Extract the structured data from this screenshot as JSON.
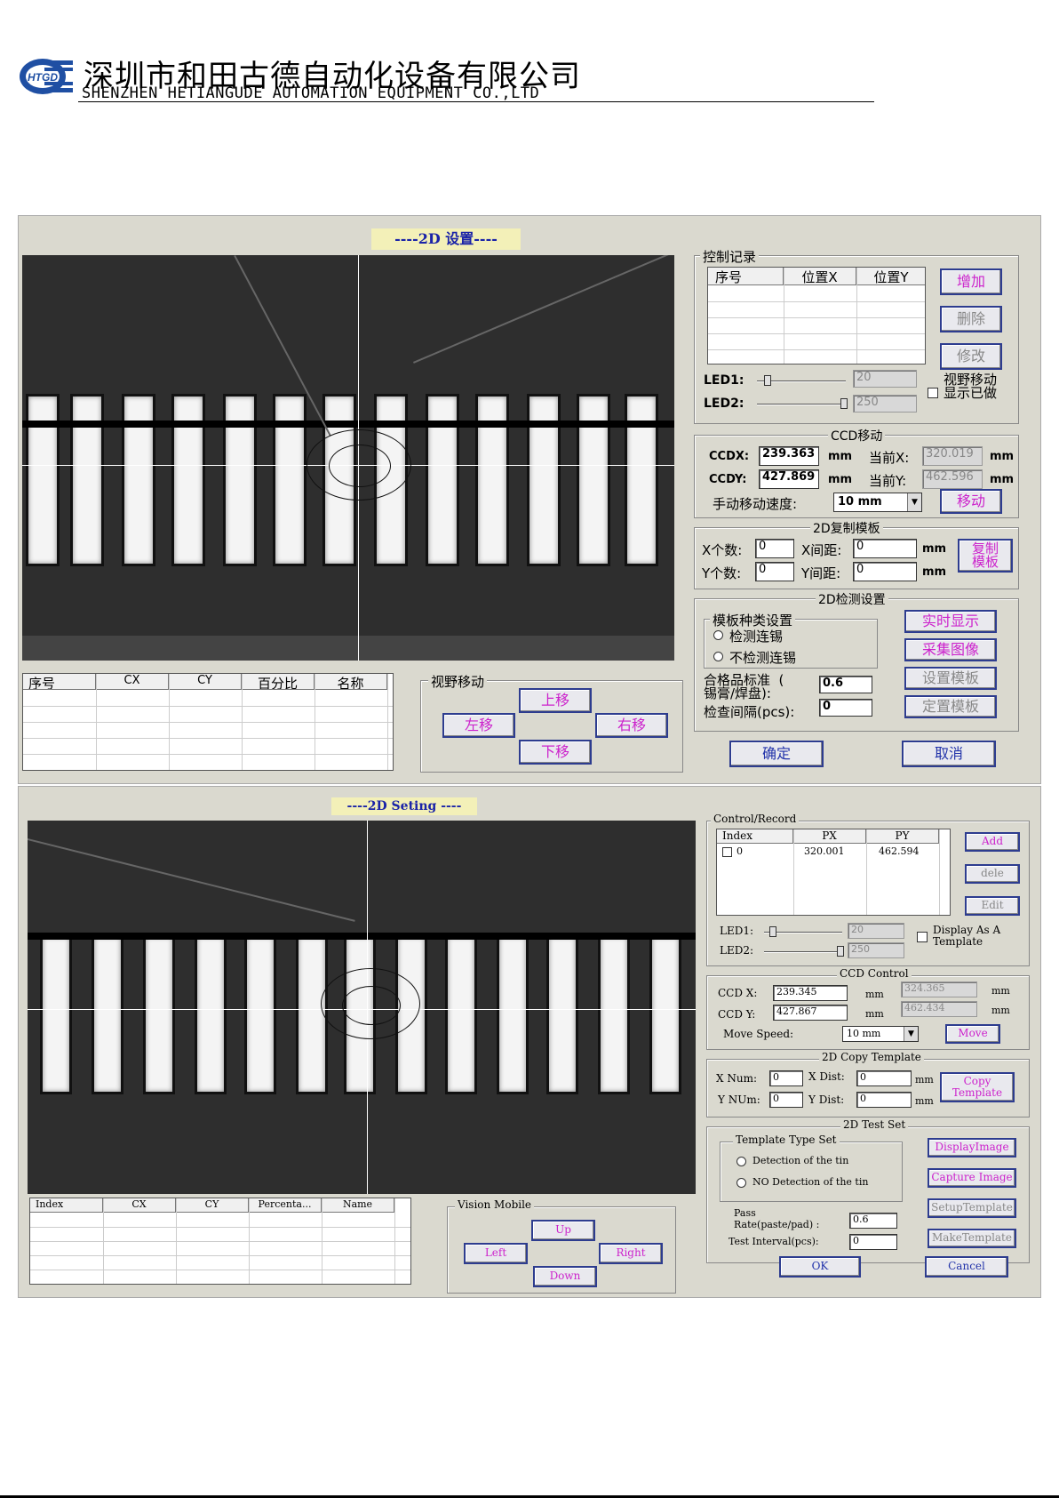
{
  "header": {
    "company_cn": "深圳市和田古德自动化设备有限公司",
    "company_en": "SHENZHEN HETIANGUDE AUTOMATION EQUIPMENT CO.,LTD",
    "logo_text": "HTGD",
    "logo_color": "#1f4fa3"
  },
  "cn": {
    "title": "----2D 设置----",
    "record": {
      "title": "控制记录",
      "columns": [
        "序号",
        "位置X",
        "位置Y"
      ],
      "add": "增加",
      "delete": "删除",
      "edit": "修改",
      "led1_label": "LED1:",
      "led1_value": "20",
      "led2_label": "LED2:",
      "led2_value": "250",
      "display_check": "视野移动\n显示已做"
    },
    "ccd": {
      "title": "CCD移动",
      "x_label": "CCDX:",
      "x_value": "239.363",
      "x_unit": "mm",
      "cur_x_label": "当前X:",
      "cur_x_value": "320.019",
      "cur_x_unit": "mm",
      "y_label": "CCDY:",
      "y_value": "427.869",
      "y_unit": "mm",
      "cur_y_label": "当前Y:",
      "cur_y_value": "462.596",
      "cur_y_unit": "mm",
      "speed_label": "手动移动速度:",
      "speed_value": "10 mm",
      "move": "移动"
    },
    "copy": {
      "title": "2D复制模板",
      "xnum_label": "X个数:",
      "xnum_value": "0",
      "xdist_label": "X间距:",
      "xdist_value": "0",
      "xdist_unit": "mm",
      "ynum_label": "Y个数:",
      "ynum_value": "0",
      "ydist_label": "Y间距:",
      "ydist_value": "0",
      "ydist_unit": "mm",
      "copy_btn": "复制\n模板"
    },
    "test": {
      "title": "2D检测设置",
      "type_title": "模板种类设置",
      "opt1": "检测连锡",
      "opt2": "不检测连锡",
      "display": "实时显示",
      "capture": "采集图像",
      "setup": "设置模板",
      "make": "定置模板",
      "pass_label": "合格品标准  (\n锡膏/焊盘):",
      "pass_value": "0.6",
      "interval_label": "检查间隔(pcs):",
      "interval_value": "0"
    },
    "ok": "确定",
    "cancel": "取消",
    "list_columns": [
      "序号",
      "CX",
      "CY",
      "百分比",
      "名称"
    ],
    "vision": {
      "title": "视野移动",
      "up": "上移",
      "left": "左移",
      "right": "右移",
      "down": "下移"
    }
  },
  "en": {
    "title": "----2D Seting ----",
    "record": {
      "title": "Control/Record",
      "columns": [
        "Index",
        "PX",
        "PY"
      ],
      "row_index": "0",
      "row_px": "320.001",
      "row_py": "462.594",
      "add": "Add",
      "delete": "dele",
      "edit": "Edit",
      "led1_label": "LED1:",
      "led1_value": "20",
      "led2_label": "LED2:",
      "led2_value": "250",
      "display_check": "Display As A\nTemplate"
    },
    "ccd": {
      "title": "CCD Control",
      "x_label": "CCD X:",
      "x_value": "239.345",
      "x_unit": "mm",
      "cur_x_value": "324.365",
      "cur_x_unit": "mm",
      "y_label": "CCD Y:",
      "y_value": "427.867",
      "y_unit": "mm",
      "cur_y_value": "462.434",
      "cur_y_unit": "mm",
      "speed_label": "Move  Speed:",
      "speed_value": "10 mm",
      "move": "Move"
    },
    "copy": {
      "title": "2D Copy Template",
      "xnum_label": "X  Num:",
      "xnum_value": "0",
      "xdist_label": "X Dist:",
      "xdist_value": "0",
      "xdist_unit": "mm",
      "ynum_label": "Y NUm:",
      "ynum_value": "0",
      "ydist_label": "Y Dist:",
      "ydist_value": "0",
      "ydist_unit": "mm",
      "copy_btn": "Copy\nTemplate"
    },
    "test": {
      "title": "2D Test Set",
      "type_title": "Template Type Set",
      "opt1": "Detection of the tin",
      "opt2": "NO Detection of the tin",
      "display": "DisplayImage",
      "capture": "Capture Image",
      "setup": "SetupTemplate",
      "make": "MakeTemplate",
      "pass_label": "Pass\nRate(paste/pad) :",
      "pass_value": "0.6",
      "interval_label": "Test Interval(pcs):",
      "interval_value": "0"
    },
    "ok": "OK",
    "cancel": "Cancel",
    "list_columns": [
      "Index",
      "CX",
      "CY",
      "Percenta...",
      "Name"
    ],
    "vision": {
      "title": "Vision Mobile",
      "up": "Up",
      "left": "Left",
      "right": "Right",
      "down": "Down"
    }
  }
}
